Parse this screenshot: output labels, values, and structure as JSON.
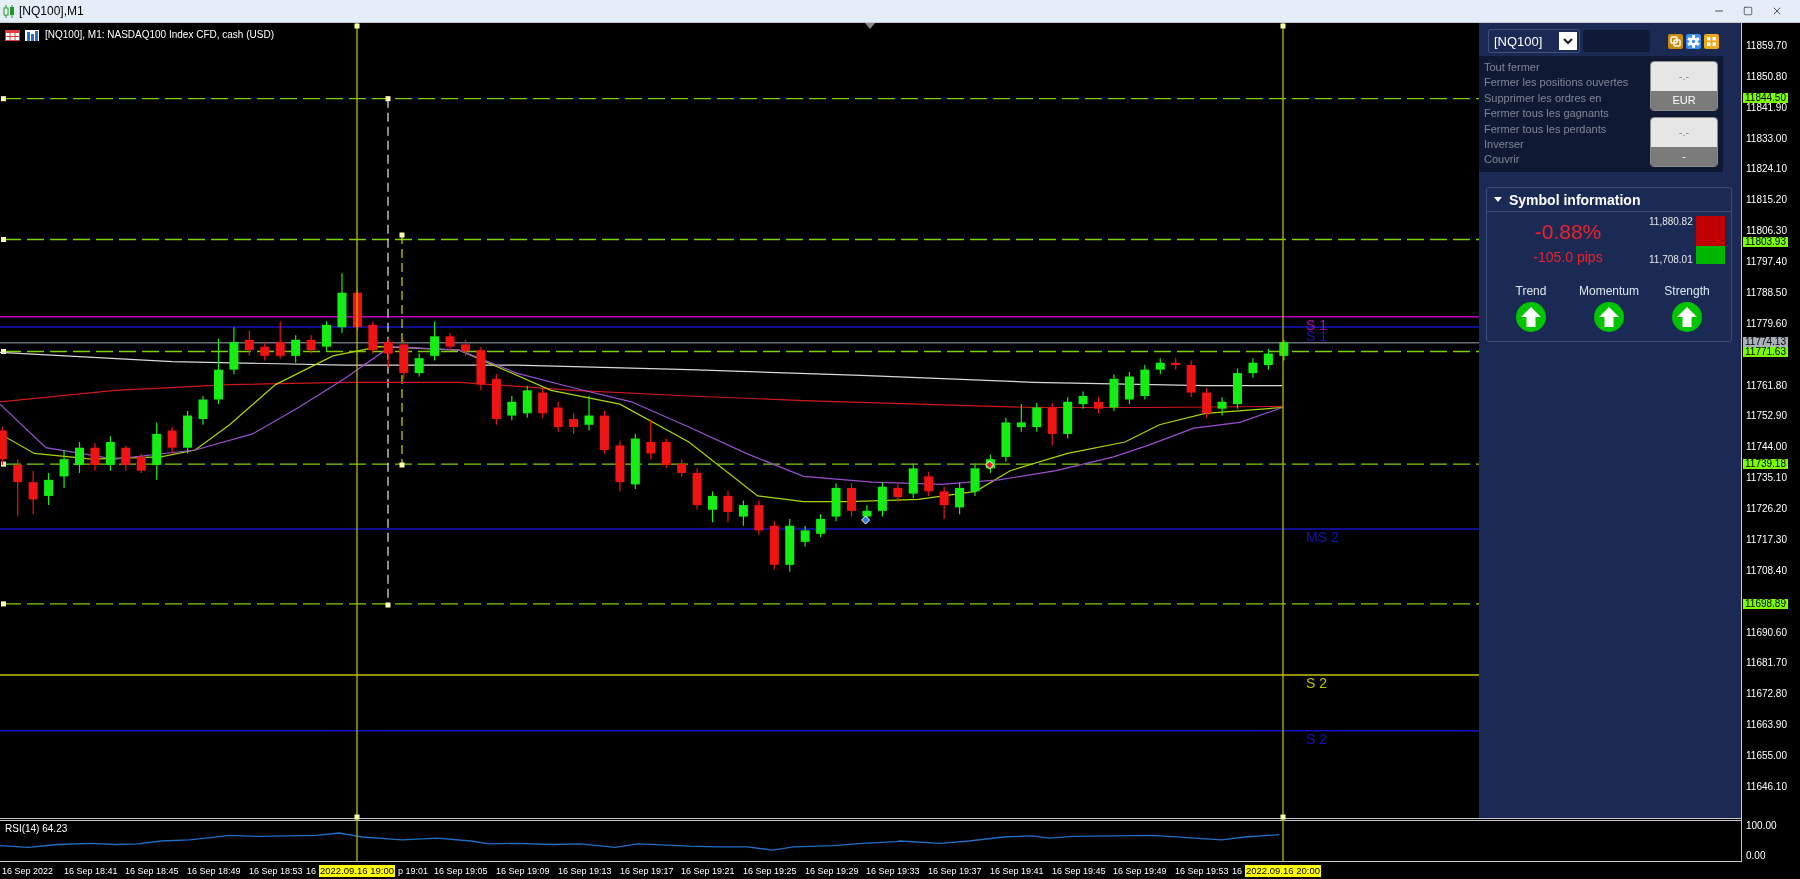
{
  "window": {
    "title": "[NQ100],M1"
  },
  "chart": {
    "header": "[NQ100], M1: NASDAQ100 Index CFD, cash (USD)",
    "level_lines": [
      {
        "label": "S 1",
        "color": "#c000c0"
      },
      {
        "label": "S 1",
        "color": "#1414c0"
      },
      {
        "label": "MS 2",
        "color": "#1414c0"
      },
      {
        "label": "S 2",
        "color": "#c0c000"
      },
      {
        "label": "S 2",
        "color": "#1414c0"
      }
    ]
  },
  "panel": {
    "symbol_select": {
      "value": "[NQ100]"
    },
    "actions": [
      "Tout fermer",
      "Fermer les positions ouvertes",
      "Supprimer les ordres en",
      "Fermer tous les gagnants",
      "Fermer tous les perdants",
      "Inverser",
      "Couvrir"
    ],
    "buttons": [
      {
        "value": "-.-",
        "label": "EUR"
      },
      {
        "value": "-.-",
        "label": "-"
      }
    ],
    "symbol_info": {
      "title": "Symbol information",
      "expanded": true,
      "change_percent": "-0.88%",
      "change_pips": "-105.0 pips",
      "high": "11,880.82",
      "low": "11,708.01",
      "range_bar": {
        "level": 0.38
      },
      "indicators": [
        {
          "label": "Trend",
          "rising": true
        },
        {
          "label": "Momentum",
          "rising": true
        },
        {
          "label": "Strength",
          "rising": true
        }
      ]
    }
  },
  "price_axis": {
    "ticks": [
      "11859.70",
      "11850.80",
      "11841.90",
      "11833.00",
      "11824.10",
      "11815.20",
      "11806.30",
      "11797.40",
      "11788.50",
      "11779.60",
      "11761.80",
      "11752.90",
      "11744.00",
      "11735.10",
      "11726.20",
      "11717.30",
      "11708.40",
      "11690.60",
      "11681.70",
      "11672.80",
      "11663.90",
      "11655.00",
      "11646.10"
    ],
    "markers": [
      {
        "text": "11844.50",
        "kind": "level"
      },
      {
        "text": "11803.93",
        "kind": "level"
      },
      {
        "text": "11774.13",
        "kind": "bid"
      },
      {
        "text": "11771.63",
        "kind": "level"
      },
      {
        "text": "11739.18",
        "kind": "level"
      },
      {
        "text": "11698.89",
        "kind": "level"
      }
    ]
  },
  "rsi": {
    "label": "RSI(14) 64.23",
    "axis": [
      "100.00",
      "0.00"
    ]
  },
  "time_axis": {
    "labels": [
      {
        "text": "16 Sep 2022",
        "kind": "tick"
      },
      {
        "text": "16 Sep 18:41",
        "kind": "tick"
      },
      {
        "text": "16 Sep 18:45",
        "kind": "tick"
      },
      {
        "text": "16 Sep 18:49",
        "kind": "tick"
      },
      {
        "text": "16 Sep 18:53",
        "kind": "tick"
      },
      {
        "text": "16",
        "kind": "tick"
      },
      {
        "text": "2022.09.16 19:00",
        "kind": "cursor"
      },
      {
        "text": "p 19:01",
        "kind": "tick"
      },
      {
        "text": "16 Sep 19:05",
        "kind": "tick"
      },
      {
        "text": "16 Sep 19:09",
        "kind": "tick"
      },
      {
        "text": "16 Sep 19:13",
        "kind": "tick"
      },
      {
        "text": "16 Sep 19:17",
        "kind": "tick"
      },
      {
        "text": "16 Sep 19:21",
        "kind": "tick"
      },
      {
        "text": "16 Sep 19:25",
        "kind": "tick"
      },
      {
        "text": "16 Sep 19:29",
        "kind": "tick"
      },
      {
        "text": "16 Sep 19:33",
        "kind": "tick"
      },
      {
        "text": "16 Sep 19:37",
        "kind": "tick"
      },
      {
        "text": "16 Sep 19:41",
        "kind": "tick"
      },
      {
        "text": "16 Sep 19:45",
        "kind": "tick"
      },
      {
        "text": "16 Sep 19:49",
        "kind": "tick"
      },
      {
        "text": "16 Sep 19:53",
        "kind": "tick"
      },
      {
        "text": "16",
        "kind": "tick"
      },
      {
        "text": "2022.09.16 20:00",
        "kind": "cursor"
      }
    ]
  }
}
